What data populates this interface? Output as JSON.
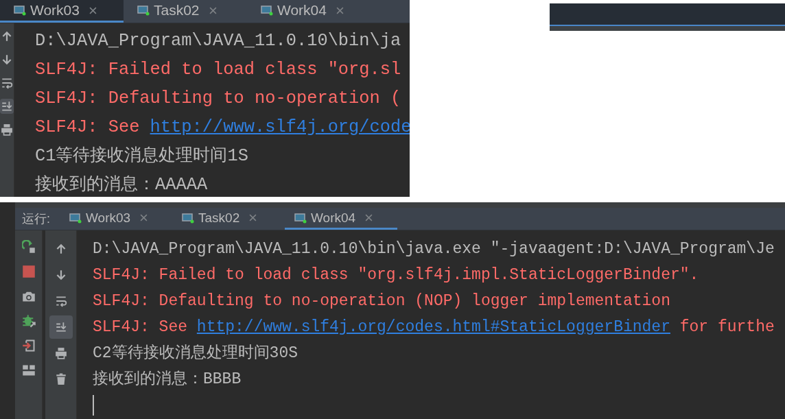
{
  "panels": [
    {
      "tabs": [
        {
          "label": "Work03",
          "selected": true
        },
        {
          "label": "Task02",
          "selected": false
        },
        {
          "label": "Work04",
          "selected": false
        }
      ],
      "tools": [
        {
          "kind": "up",
          "selected": false
        },
        {
          "kind": "down",
          "selected": false
        },
        {
          "kind": "wrap",
          "selected": false
        },
        {
          "kind": "scroll-end",
          "selected": true
        },
        {
          "kind": "print",
          "selected": false
        }
      ],
      "lines": [
        {
          "kind": "command",
          "text": "D:\\JAVA_Program\\JAVA_11.0.10\\bin\\ja"
        },
        {
          "kind": "error",
          "text": "SLF4J: Failed to load class \"org.sl"
        },
        {
          "kind": "error",
          "text": "SLF4J: Defaulting to no-operation ("
        },
        {
          "kind": "error",
          "text": "SLF4J: See ",
          "link": "http://www.slf4j.org/code"
        },
        {
          "kind": "output",
          "text": "C1等待接收消息处理时间1S"
        },
        {
          "kind": "output",
          "text": "接收到的消息：AAAAA"
        }
      ]
    },
    {
      "run_label": "运行:",
      "tabs": [
        {
          "label": "Work03",
          "selected": false
        },
        {
          "label": "Task02",
          "selected": false
        },
        {
          "label": "Work04",
          "selected": true
        }
      ],
      "actions": [
        {
          "kind": "rerun"
        },
        {
          "kind": "stop"
        },
        {
          "kind": "camera"
        },
        {
          "kind": "bug"
        },
        {
          "kind": "exit"
        },
        {
          "kind": "layout"
        }
      ],
      "tools": [
        {
          "kind": "up",
          "selected": false
        },
        {
          "kind": "down",
          "selected": false
        },
        {
          "kind": "wrap",
          "selected": false
        },
        {
          "kind": "scroll-end",
          "selected": true
        },
        {
          "kind": "print",
          "selected": false
        },
        {
          "kind": "trash",
          "selected": false
        }
      ],
      "lines": [
        {
          "kind": "command",
          "text": "D:\\JAVA_Program\\JAVA_11.0.10\\bin\\java.exe \"-javaagent:D:\\JAVA_Program\\Je"
        },
        {
          "kind": "error",
          "text": "SLF4J: Failed to load class \"org.slf4j.impl.StaticLoggerBinder\"."
        },
        {
          "kind": "error",
          "text": "SLF4J: Defaulting to no-operation (NOP) logger implementation"
        },
        {
          "kind": "error",
          "text": "SLF4J: See ",
          "link": "http://www.slf4j.org/codes.html#StaticLoggerBinder",
          "tail": " for furthe"
        },
        {
          "kind": "output",
          "text": "C2等待接收消息处理时间30S"
        },
        {
          "kind": "output",
          "text": "接收到的消息：BBBB"
        }
      ],
      "cursor": true
    }
  ]
}
